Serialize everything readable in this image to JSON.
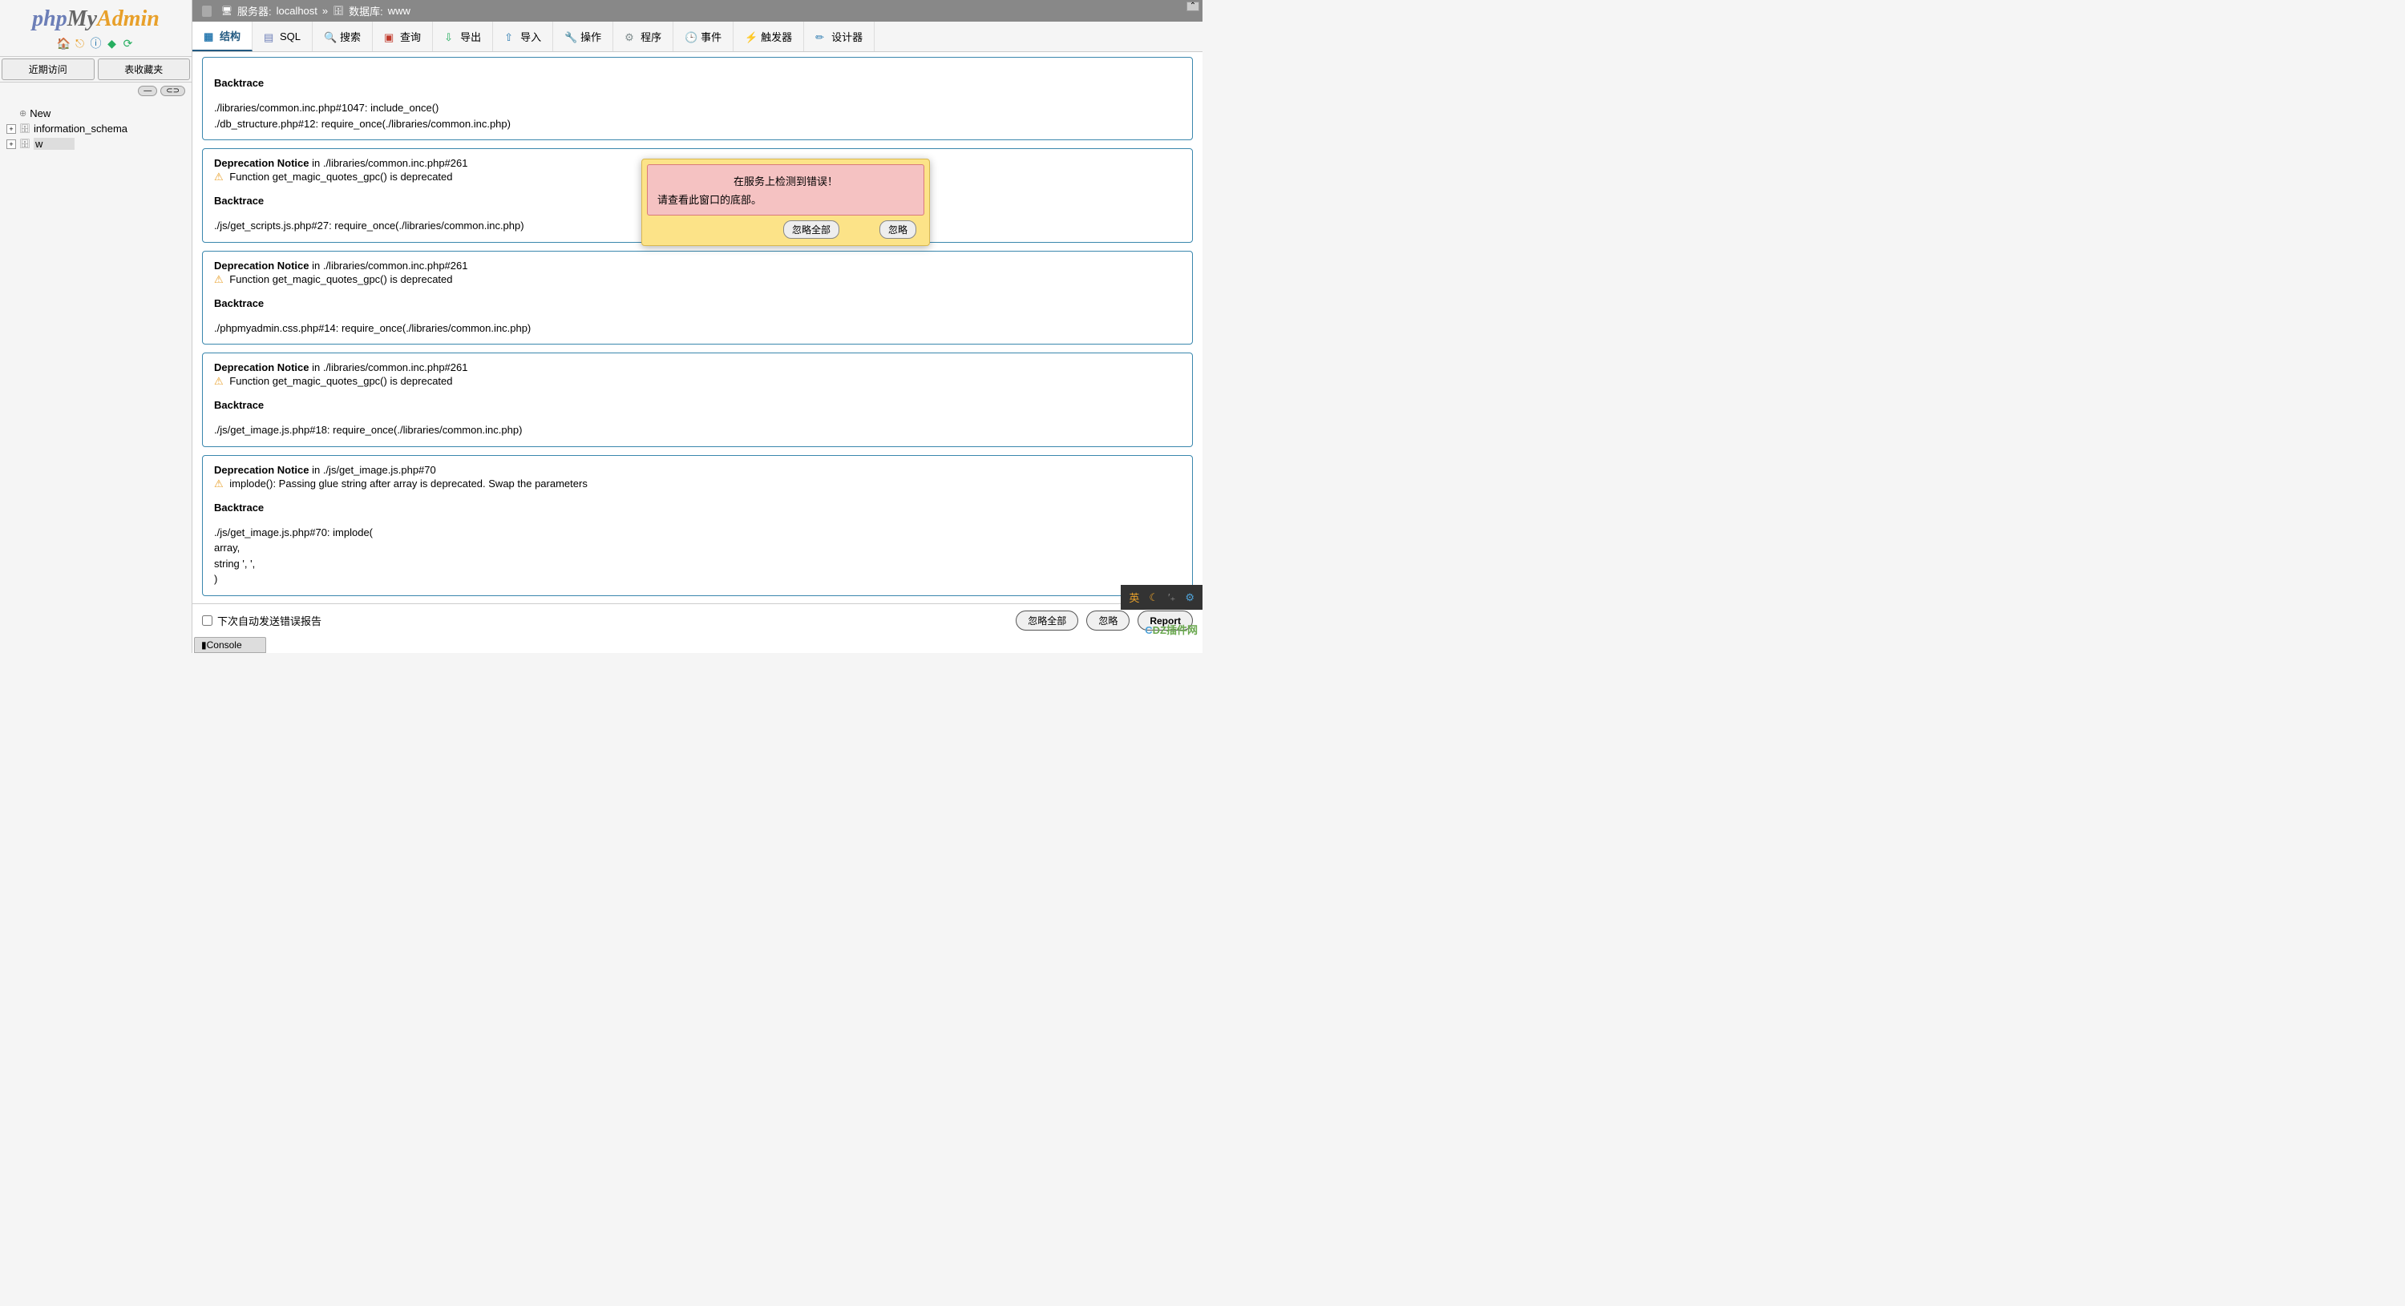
{
  "logo": {
    "php": "php",
    "my": "My",
    "admin": "Admin"
  },
  "sidebar": {
    "recent_tab": "近期访问",
    "favorites_tab": "表收藏夹",
    "collapse_btn": "—",
    "link_btn": "⊂⊃",
    "tree": {
      "new": "New",
      "info_schema": "information_schema",
      "db_w": "w"
    }
  },
  "breadcrumb": {
    "server_label": "服务器:",
    "server_value": "localhost",
    "db_label": "数据库:",
    "db_value": "www"
  },
  "tabs": {
    "structure": "结构",
    "sql": "SQL",
    "search": "搜索",
    "query": "查询",
    "export": "导出",
    "import": "导入",
    "operations": "操作",
    "procedures": "程序",
    "events": "事件",
    "triggers": "触发器",
    "designer": "设计器"
  },
  "labels": {
    "deprecation_notice": "Deprecation Notice",
    "in": "in",
    "backtrace": "Backtrace"
  },
  "notices": [
    {
      "location": "",
      "message": "",
      "show_header": false,
      "backtrace": [
        "./libraries/common.inc.php#1047: include_once()",
        "./db_structure.php#12: require_once(./libraries/common.inc.php)"
      ]
    },
    {
      "location": "./libraries/common.inc.php#261",
      "message": "Function get_magic_quotes_gpc() is deprecated",
      "show_header": true,
      "backtrace": [
        "./js/get_scripts.js.php#27: require_once(./libraries/common.inc.php)"
      ]
    },
    {
      "location": "./libraries/common.inc.php#261",
      "message": "Function get_magic_quotes_gpc() is deprecated",
      "show_header": true,
      "backtrace": [
        "./phpmyadmin.css.php#14: require_once(./libraries/common.inc.php)"
      ]
    },
    {
      "location": "./libraries/common.inc.php#261",
      "message": "Function get_magic_quotes_gpc() is deprecated",
      "show_header": true,
      "backtrace": [
        "./js/get_image.js.php#18: require_once(./libraries/common.inc.php)"
      ]
    },
    {
      "location": "./js/get_image.js.php#70",
      "message": "implode(): Passing glue string after array is deprecated. Swap the parameters",
      "show_header": true,
      "backtrace": [
        "./js/get_image.js.php#70: implode(",
        "array,",
        "string ', ',",
        ")"
      ]
    }
  ],
  "modal": {
    "title": "在服务上检测到错误！",
    "body": "请查看此窗口的底部。",
    "ignore_all": "忽略全部",
    "ignore": "忽略"
  },
  "footer": {
    "auto_send": "下次自动发送错误报告",
    "ignore_all": "忽略全部",
    "ignore": "忽略",
    "report": "Report"
  },
  "console": "Console",
  "floatbar": {
    "lang": "英"
  },
  "watermark": {
    "c": "C",
    "rest": "DZ插件网"
  }
}
